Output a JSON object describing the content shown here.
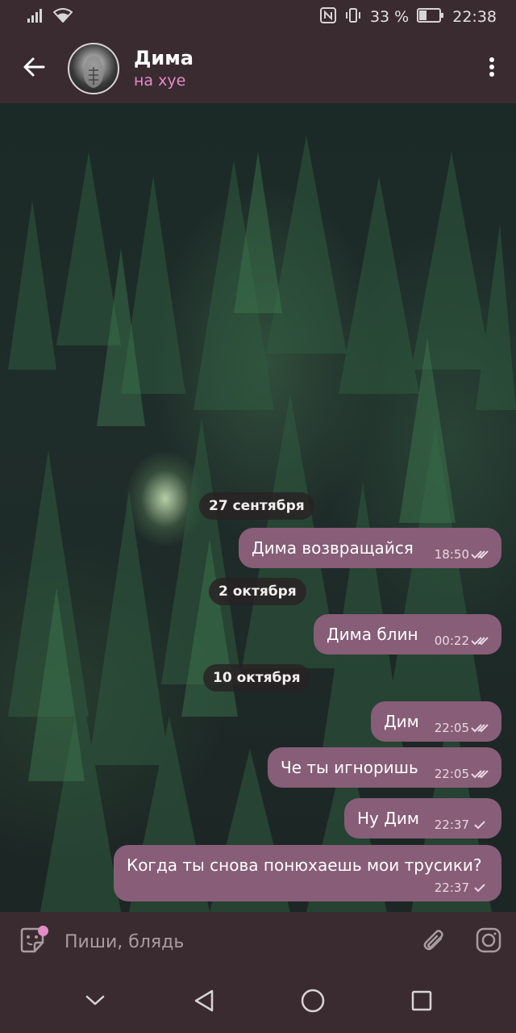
{
  "status_bar": {
    "battery_percent": "33 %",
    "time": "22:38",
    "icons": [
      "signal-icon",
      "wifi-icon",
      "nfc-icon",
      "vibrate-icon",
      "battery-icon"
    ]
  },
  "header": {
    "contact_name": "Дима",
    "contact_status": "на хуе",
    "icons": [
      "back-arrow-icon",
      "avatar",
      "more-vertical-icon"
    ]
  },
  "chat": {
    "messages": [
      {
        "type": "date",
        "text": "27 сентября"
      },
      {
        "type": "out",
        "text": "Дима возвращайся",
        "time": "18:50",
        "status": "read"
      },
      {
        "type": "date",
        "text": "2 октября"
      },
      {
        "type": "out",
        "text": "Дима блин",
        "time": "00:22",
        "status": "read"
      },
      {
        "type": "date",
        "text": "10 октября"
      },
      {
        "type": "out",
        "text": "Дим",
        "time": "22:05",
        "status": "read"
      },
      {
        "type": "out",
        "text": "Че ты игноришь",
        "time": "22:05",
        "status": "read"
      },
      {
        "type": "out",
        "text": "Ну Дим",
        "time": "22:37",
        "status": "sent"
      },
      {
        "type": "out",
        "text": "Когда ты снова понюхаешь мои трусики?",
        "time": "22:37",
        "status": "sent"
      }
    ]
  },
  "input_bar": {
    "placeholder": "Пиши, блядь",
    "icons": [
      "sticker-icon",
      "attach-icon",
      "camera-icon"
    ]
  },
  "nav_bar": {
    "icons": [
      "collapse-icon",
      "back-icon",
      "home-icon",
      "recents-icon"
    ]
  },
  "colors": {
    "bar_background": "#3a2b30",
    "bubble_background": "#875d77",
    "accent_pink": "#e38cc6",
    "date_chip_background": "#282224"
  }
}
